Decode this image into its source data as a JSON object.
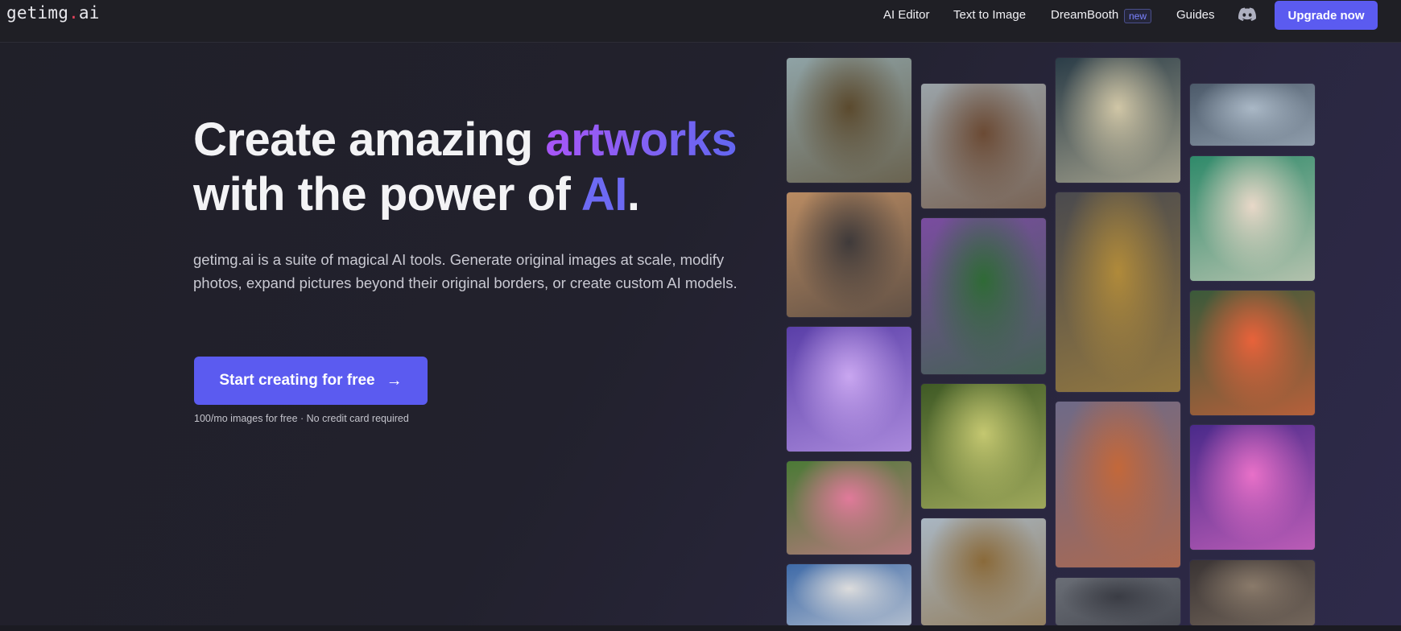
{
  "header": {
    "logo_main": "getimg",
    "logo_dot": ".",
    "logo_ext": "ai",
    "nav": {
      "ai_editor": "AI Editor",
      "text_to_image": "Text to Image",
      "dreambooth": "DreamBooth",
      "dreambooth_badge": "new",
      "guides": "Guides"
    },
    "discord_icon": "discord-icon",
    "upgrade_label": "Upgrade now"
  },
  "hero": {
    "title_part1": "Create amazing ",
    "title_highlight": "artworks",
    "title_part2": "with the power of ",
    "title_ai": "AI",
    "title_end": ".",
    "description": "getimg.ai is a suite of magical AI tools. Generate original images at scale, modify photos, expand pictures beyond their original borders, or create custom AI models.",
    "cta_label": "Start creating for free",
    "cta_icon": "arrow-right-icon",
    "cta_note": "100/mo images for free · No credit card required"
  },
  "gallery": {
    "tiles": [
      {
        "name": "portrait-man-coat",
        "colors": [
          "#8fa3a6",
          "#5b4a2e"
        ]
      },
      {
        "name": "cabin-bedroom",
        "colors": [
          "#b98b62",
          "#3f3a3a"
        ]
      },
      {
        "name": "cosmic-cat",
        "colors": [
          "#5a3fa8",
          "#c9a6f0"
        ]
      },
      {
        "name": "rose-garden",
        "colors": [
          "#4b7a36",
          "#e07a9a"
        ]
      },
      {
        "name": "horse-rider",
        "colors": [
          "#3e6aa8",
          "#dcdcdc"
        ]
      },
      {
        "name": "curly-bearded-man",
        "colors": [
          "#9aa3a8",
          "#6b4a34"
        ]
      },
      {
        "name": "flower-goddess",
        "colors": [
          "#7a4ca0",
          "#2f6a36"
        ]
      },
      {
        "name": "enchanted-tree",
        "colors": [
          "#3f5a25",
          "#c4c770"
        ]
      },
      {
        "name": "jungle-pyramid",
        "colors": [
          "#a9b6c2",
          "#8a6a3a"
        ]
      },
      {
        "name": "stormy-sea",
        "colors": [
          "#2b3d48",
          "#d0c6a6"
        ]
      },
      {
        "name": "golden-skull",
        "colors": [
          "#4a4a4e",
          "#b08a3a"
        ]
      },
      {
        "name": "mushroom-forest",
        "colors": [
          "#6e6a88",
          "#c3683a"
        ]
      },
      {
        "name": "misty-street",
        "colors": [
          "#6a6e76",
          "#3a3c44"
        ]
      },
      {
        "name": "cloudscape",
        "colors": [
          "#4c5a6a",
          "#aab8c6"
        ]
      },
      {
        "name": "anime-green-hair-girl",
        "colors": [
          "#2f8a6a",
          "#e8d8c8"
        ]
      },
      {
        "name": "koi-pond",
        "colors": [
          "#3a5a3a",
          "#e8623a"
        ]
      },
      {
        "name": "neon-hamster",
        "colors": [
          "#4a2a8a",
          "#e870c8"
        ]
      },
      {
        "name": "armored-woman",
        "colors": [
          "#3a3434",
          "#8a7a6a"
        ]
      }
    ]
  }
}
